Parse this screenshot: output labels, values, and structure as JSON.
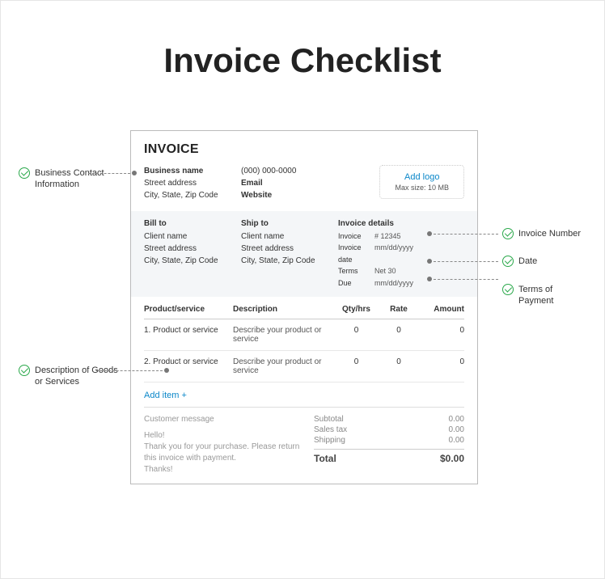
{
  "title": "Invoice Checklist",
  "invoice": {
    "heading": "INVOICE",
    "business": {
      "name": "Business name",
      "street": "Street address",
      "city": "City, State, Zip Code"
    },
    "contact": {
      "phone": "(000) 000-0000",
      "email": "Email",
      "website": "Website"
    },
    "logo": {
      "add": "Add logo",
      "max": "Max size: 10 MB"
    },
    "billto": {
      "title": "Bill to",
      "client": "Client name",
      "street": "Street address",
      "city": "City, State, Zip Code"
    },
    "shipto": {
      "title": "Ship to",
      "client": "Client name",
      "street": "Street address",
      "city": "City, State, Zip Code"
    },
    "details": {
      "title": "Invoice details",
      "inv_label": "Invoice",
      "inv_val": "# 12345",
      "date_label": "Invoice date",
      "date_val": "mm/dd/yyyy",
      "terms_label": "Terms",
      "terms_val": "Net 30",
      "due_label": "Due",
      "due_val": "mm/dd/yyyy"
    },
    "columns": {
      "prod": "Product/service",
      "desc": "Description",
      "qty": "Qty/hrs",
      "rate": "Rate",
      "amt": "Amount"
    },
    "items": [
      {
        "num": "1.",
        "name": "Product or service",
        "desc": "Describe your product or service",
        "qty": "0",
        "rate": "0",
        "amt": "0"
      },
      {
        "num": "2.",
        "name": "Product or service",
        "desc": "Describe your product or service",
        "qty": "0",
        "rate": "0",
        "amt": "0"
      }
    ],
    "add_item": "Add item +",
    "message": {
      "title": "Customer message",
      "greeting": "Hello!",
      "body": "Thank you for your purchase. Please return this invoice with payment.",
      "closing": "Thanks!"
    },
    "totals": {
      "subtotal_label": "Subtotal",
      "subtotal_val": "0.00",
      "tax_label": "Sales tax",
      "tax_val": "0.00",
      "ship_label": "Shipping",
      "ship_val": "0.00",
      "total_label": "Total",
      "total_val": "$0.00"
    }
  },
  "annotations": {
    "biz": "Business Contact Information",
    "goods": "Description of Goods or Services",
    "invnum": "Invoice Number",
    "date": "Date",
    "terms": "Terms of Payment"
  }
}
